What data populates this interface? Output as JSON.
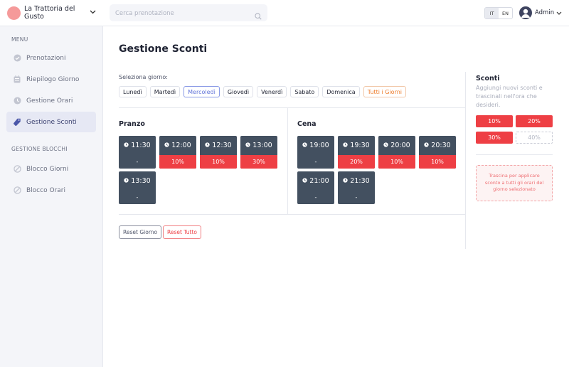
{
  "brand": {
    "name": "La Trattoria del Gusto"
  },
  "sidebar": {
    "menu_label": "MENU",
    "items": [
      {
        "label": "Prenotazioni",
        "icon": "check-circle-icon"
      },
      {
        "label": "Riepilogo Giorno",
        "icon": "calendar-icon"
      },
      {
        "label": "Gestione Orari",
        "icon": "clock-icon"
      },
      {
        "label": "Gestione Sconti",
        "icon": "tag-icon",
        "active": true
      }
    ],
    "blocks_label": "GESTIONE BLOCCHI",
    "block_items": [
      {
        "label": "Blocco Giorni",
        "icon": "block-icon"
      },
      {
        "label": "Blocco Orari",
        "icon": "block-icon"
      }
    ]
  },
  "search": {
    "placeholder": "Cerca prenotazione"
  },
  "lang": {
    "it": "IT",
    "en": "EN",
    "selected": "IT"
  },
  "user": {
    "name": "Admin"
  },
  "page": {
    "title": "Gestione Sconti",
    "day_label": "Seleziona giorno:",
    "days": [
      "Lunedì",
      "Martedì",
      "Mercoledì",
      "Giovedì",
      "Venerdì",
      "Sabato",
      "Domenica",
      "Tutti i Giorni"
    ],
    "selected_day": "Mercoledì"
  },
  "pranzo": {
    "title": "Pranzo",
    "slots": [
      {
        "time": "11:30",
        "discount": "-"
      },
      {
        "time": "12:00",
        "discount": "10%"
      },
      {
        "time": "12:30",
        "discount": "10%"
      },
      {
        "time": "13:00",
        "discount": "30%"
      },
      {
        "time": "13:30",
        "discount": "-"
      }
    ]
  },
  "cena": {
    "title": "Cena",
    "slots": [
      {
        "time": "19:00",
        "discount": "-"
      },
      {
        "time": "19:30",
        "discount": "20%"
      },
      {
        "time": "20:00",
        "discount": "10%"
      },
      {
        "time": "20:30",
        "discount": "10%"
      },
      {
        "time": "21:00",
        "discount": "-"
      },
      {
        "time": "21:30",
        "discount": "-"
      }
    ]
  },
  "actions": {
    "reset_day": "Reset Giorno",
    "reset_all": "Reset Tutto"
  },
  "discounts_panel": {
    "title": "Sconti",
    "description": "Aggiungi nuovi sconti e trascinali nell'ora che desideri.",
    "chips": [
      {
        "label": "10%",
        "style": "filled"
      },
      {
        "label": "20%",
        "style": "filled"
      },
      {
        "label": "30%",
        "style": "filled"
      },
      {
        "label": "40%",
        "style": "dashed"
      }
    ],
    "drop_text": "Trascina per applicare sconto a tutti gli orari del giorno selezionato"
  },
  "colors": {
    "accent_red": "#ee3f44",
    "slot_bg": "#435060",
    "selected_blue": "#6173d9",
    "all_orange": "#ee7d2c"
  }
}
